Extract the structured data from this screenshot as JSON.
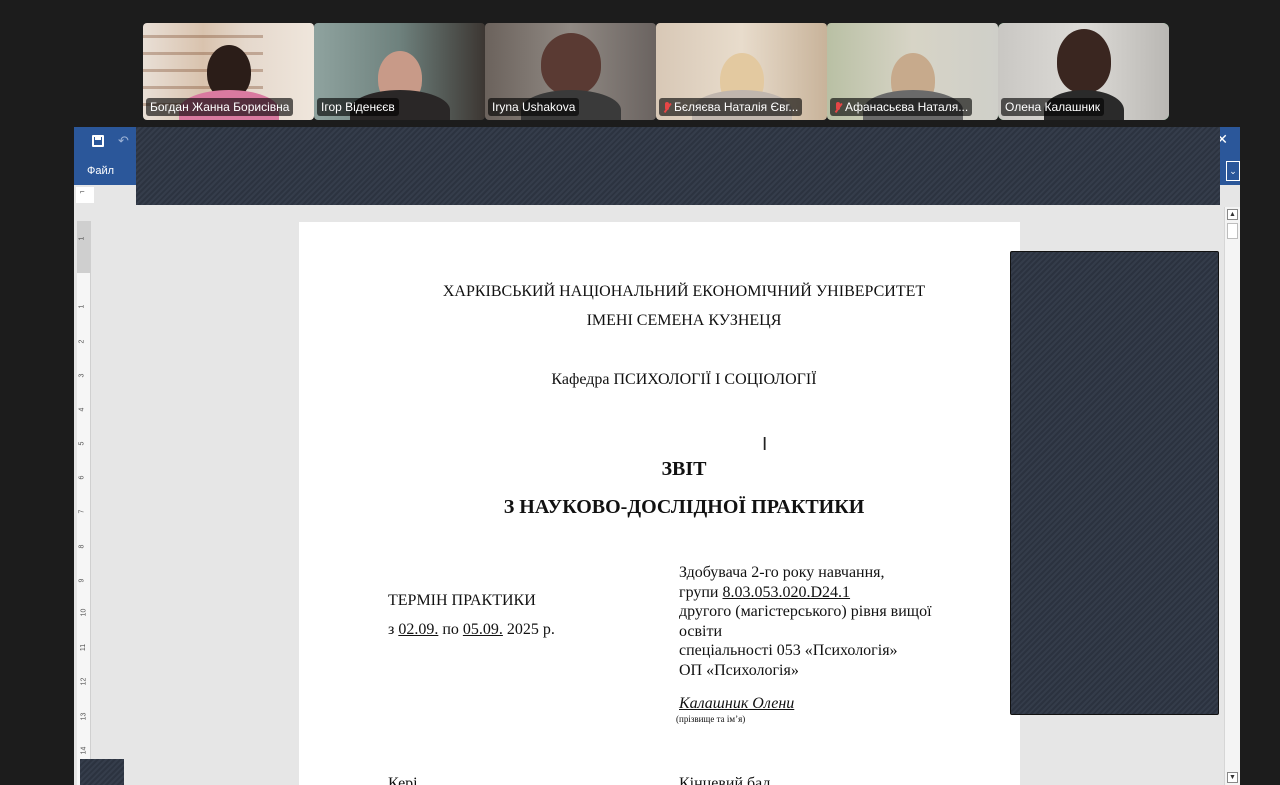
{
  "participants": [
    {
      "name": "Богдан Жанна Борисівна",
      "muted": false,
      "active": false
    },
    {
      "name": "Ігор Віденєєв",
      "muted": false,
      "active": false
    },
    {
      "name": "Iryna Ushakova",
      "muted": false,
      "active": false
    },
    {
      "name": "Бєляєва Наталія Євг...",
      "muted": true,
      "active": false
    },
    {
      "name": "Афанасьєва Наталя...",
      "muted": true,
      "active": false
    },
    {
      "name": "Олена Калашник",
      "muted": false,
      "active": true
    }
  ],
  "word": {
    "file_tab": "Файл",
    "save_icon": "save-icon",
    "undo_icon": "undo-icon",
    "close_glyph": "✕",
    "dropdown_glyph": "⌄",
    "ruler_corner": "⌐",
    "ruler_numbers": [
      "1",
      "1",
      "2",
      "3",
      "4",
      "5",
      "6",
      "7",
      "8",
      "9",
      "10",
      "11",
      "12",
      "13",
      "14"
    ]
  },
  "document": {
    "university_line1": "ХАРКІВСЬКИЙ НАЦІОНАЛЬНИЙ ЕКОНОМІЧНИЙ УНІВЕРСИТЕТ",
    "university_line2": "ІМЕНІ СЕМЕНА КУЗНЕЦЯ",
    "department": "Кафедра ПСИХОЛОГІЇ І СОЦІОЛОГІЇ",
    "title1": "ЗВІТ",
    "title2": "З НАУКОВО-ДОСЛІДНОЇ ПРАКТИКИ",
    "term_label": "ТЕРМІН ПРАКТИКИ",
    "term_from_prefix": "з",
    "term_from": "02.09.",
    "term_to_prefix": "по",
    "term_to": "05.09.",
    "term_year": "2025 р.",
    "student_line1": "Здобувача 2-го року навчання,",
    "group_prefix": "групи",
    "group": "8.03.053.020.D24.1",
    "level_line1": "другого (магістерського) рівня вищої",
    "level_line2": "освіти",
    "specialty": "спеціальності 053 «Психологія»",
    "program": "ОП «Психологія»",
    "student_name": "Калашник Олени",
    "name_hint": "(прізвище та ім’я)",
    "bottom_left": "Кері...",
    "bottom_right": "Кінцевий бал..."
  }
}
